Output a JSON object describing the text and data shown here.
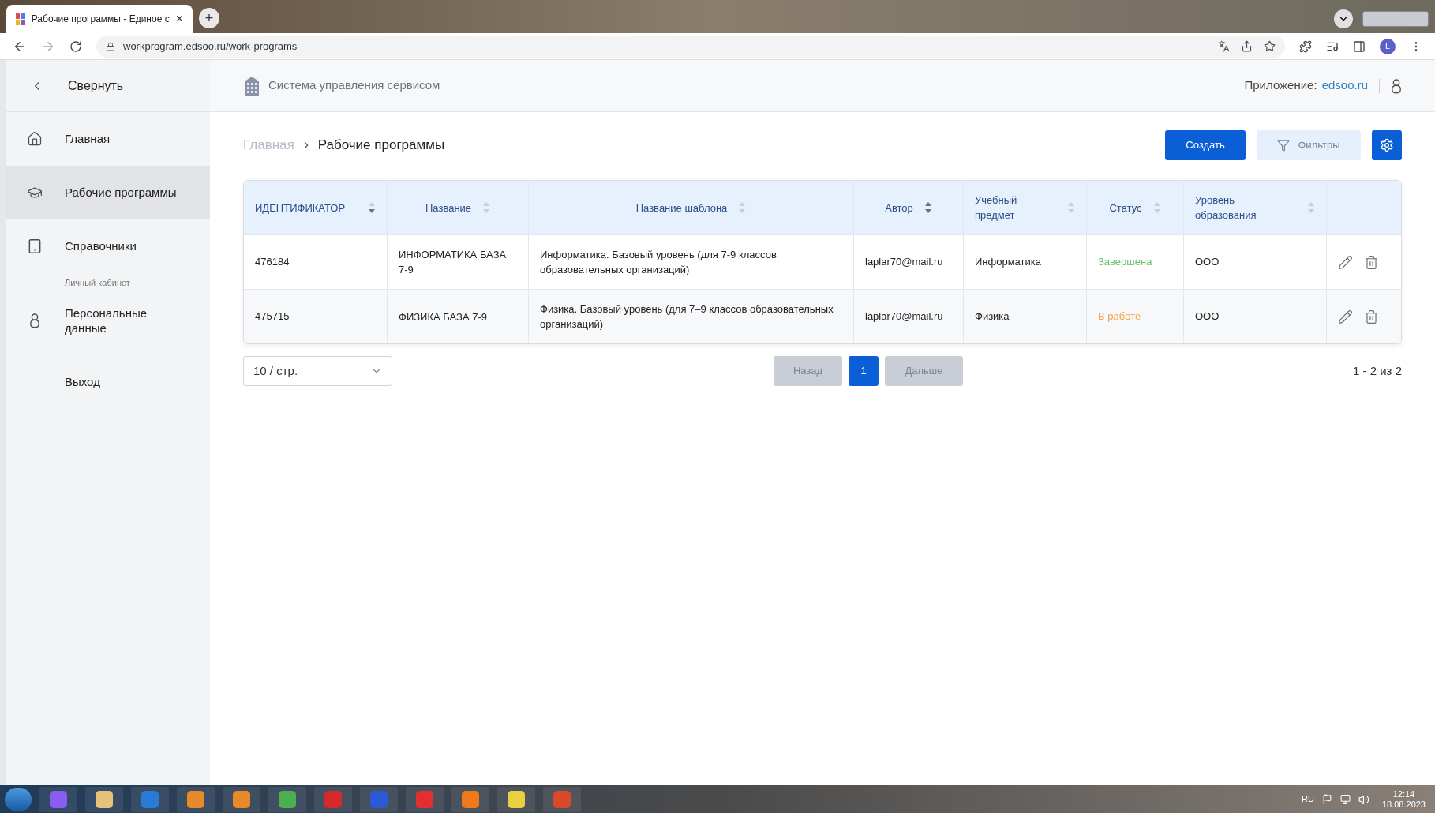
{
  "browser": {
    "tab_title": "Рабочие программы - Единое с",
    "tab_close": "×",
    "new_tab": "+",
    "url": "workprogram.edsoo.ru/work-programs",
    "profile": "L"
  },
  "sidebar": {
    "collapse": "Свернуть",
    "items": [
      {
        "label": "Главная",
        "selected": false
      },
      {
        "label": "Рабочие программы",
        "selected": true
      },
      {
        "label": "Справочники",
        "selected": false
      }
    ],
    "section": "Личный кабинет",
    "account_items": [
      {
        "label": "Персональные данные"
      },
      {
        "label": "Выход"
      }
    ]
  },
  "header": {
    "system_title": "Система управления сервисом",
    "app_label": "Приложение:",
    "app_link": "edsoo.ru"
  },
  "breadcrumb": [
    {
      "label": "Главная",
      "current": false
    },
    {
      "label": "Рабочие программы",
      "current": true
    }
  ],
  "actions": {
    "create": "Создать",
    "filters": "Фильтры"
  },
  "table": {
    "columns": [
      {
        "label": "ИДЕНТИФИКАТОР",
        "sorted_ascending": false,
        "sorted_descending": true
      },
      {
        "label": "Название",
        "sorted_ascending": false,
        "sorted_descending": false
      },
      {
        "label": "Название шаблона",
        "sorted_ascending": false,
        "sorted_descending": false
      },
      {
        "label": "Автор",
        "sorted_ascending": true,
        "sorted_descending": true
      },
      {
        "label": "Учебный предмет",
        "sorted_ascending": false,
        "sorted_descending": false
      },
      {
        "label": "Статус",
        "sorted_ascending": false,
        "sorted_descending": false
      },
      {
        "label": "Уровень образования",
        "sorted_ascending": false,
        "sorted_descending": false
      }
    ],
    "rows": [
      {
        "id": "476184",
        "name": "ИНФОРМАТИКА БАЗА 7-9",
        "template": "Информатика. Базовый уровень (для 7-9 классов образовательных организаций)",
        "author": "laplar70@mail.ru",
        "subject": "Информатика",
        "status": "Завершена",
        "color": "#6cbf6a",
        "level": "ООО"
      },
      {
        "id": "475715",
        "name": "ФИЗИКА БАЗА 7-9",
        "template": "Физика. Базовый уровень (для 7–9 классов образовательных организаций)",
        "author": "laplar70@mail.ru",
        "subject": "Физика",
        "status": "В работе",
        "color": "#f8a14d",
        "level": "ООО"
      }
    ]
  },
  "pagination": {
    "page_size": "10 / стр.",
    "prev": {
      "label": "Назад",
      "disabled": true
    },
    "pages": [
      {
        "label": "1",
        "selected": true
      }
    ],
    "next": {
      "label": "Дальше",
      "disabled": true
    },
    "range": "1 - 2 из 2"
  },
  "taskbar": {
    "language": "RU",
    "time": "12:14",
    "date": "18.08.2023"
  }
}
